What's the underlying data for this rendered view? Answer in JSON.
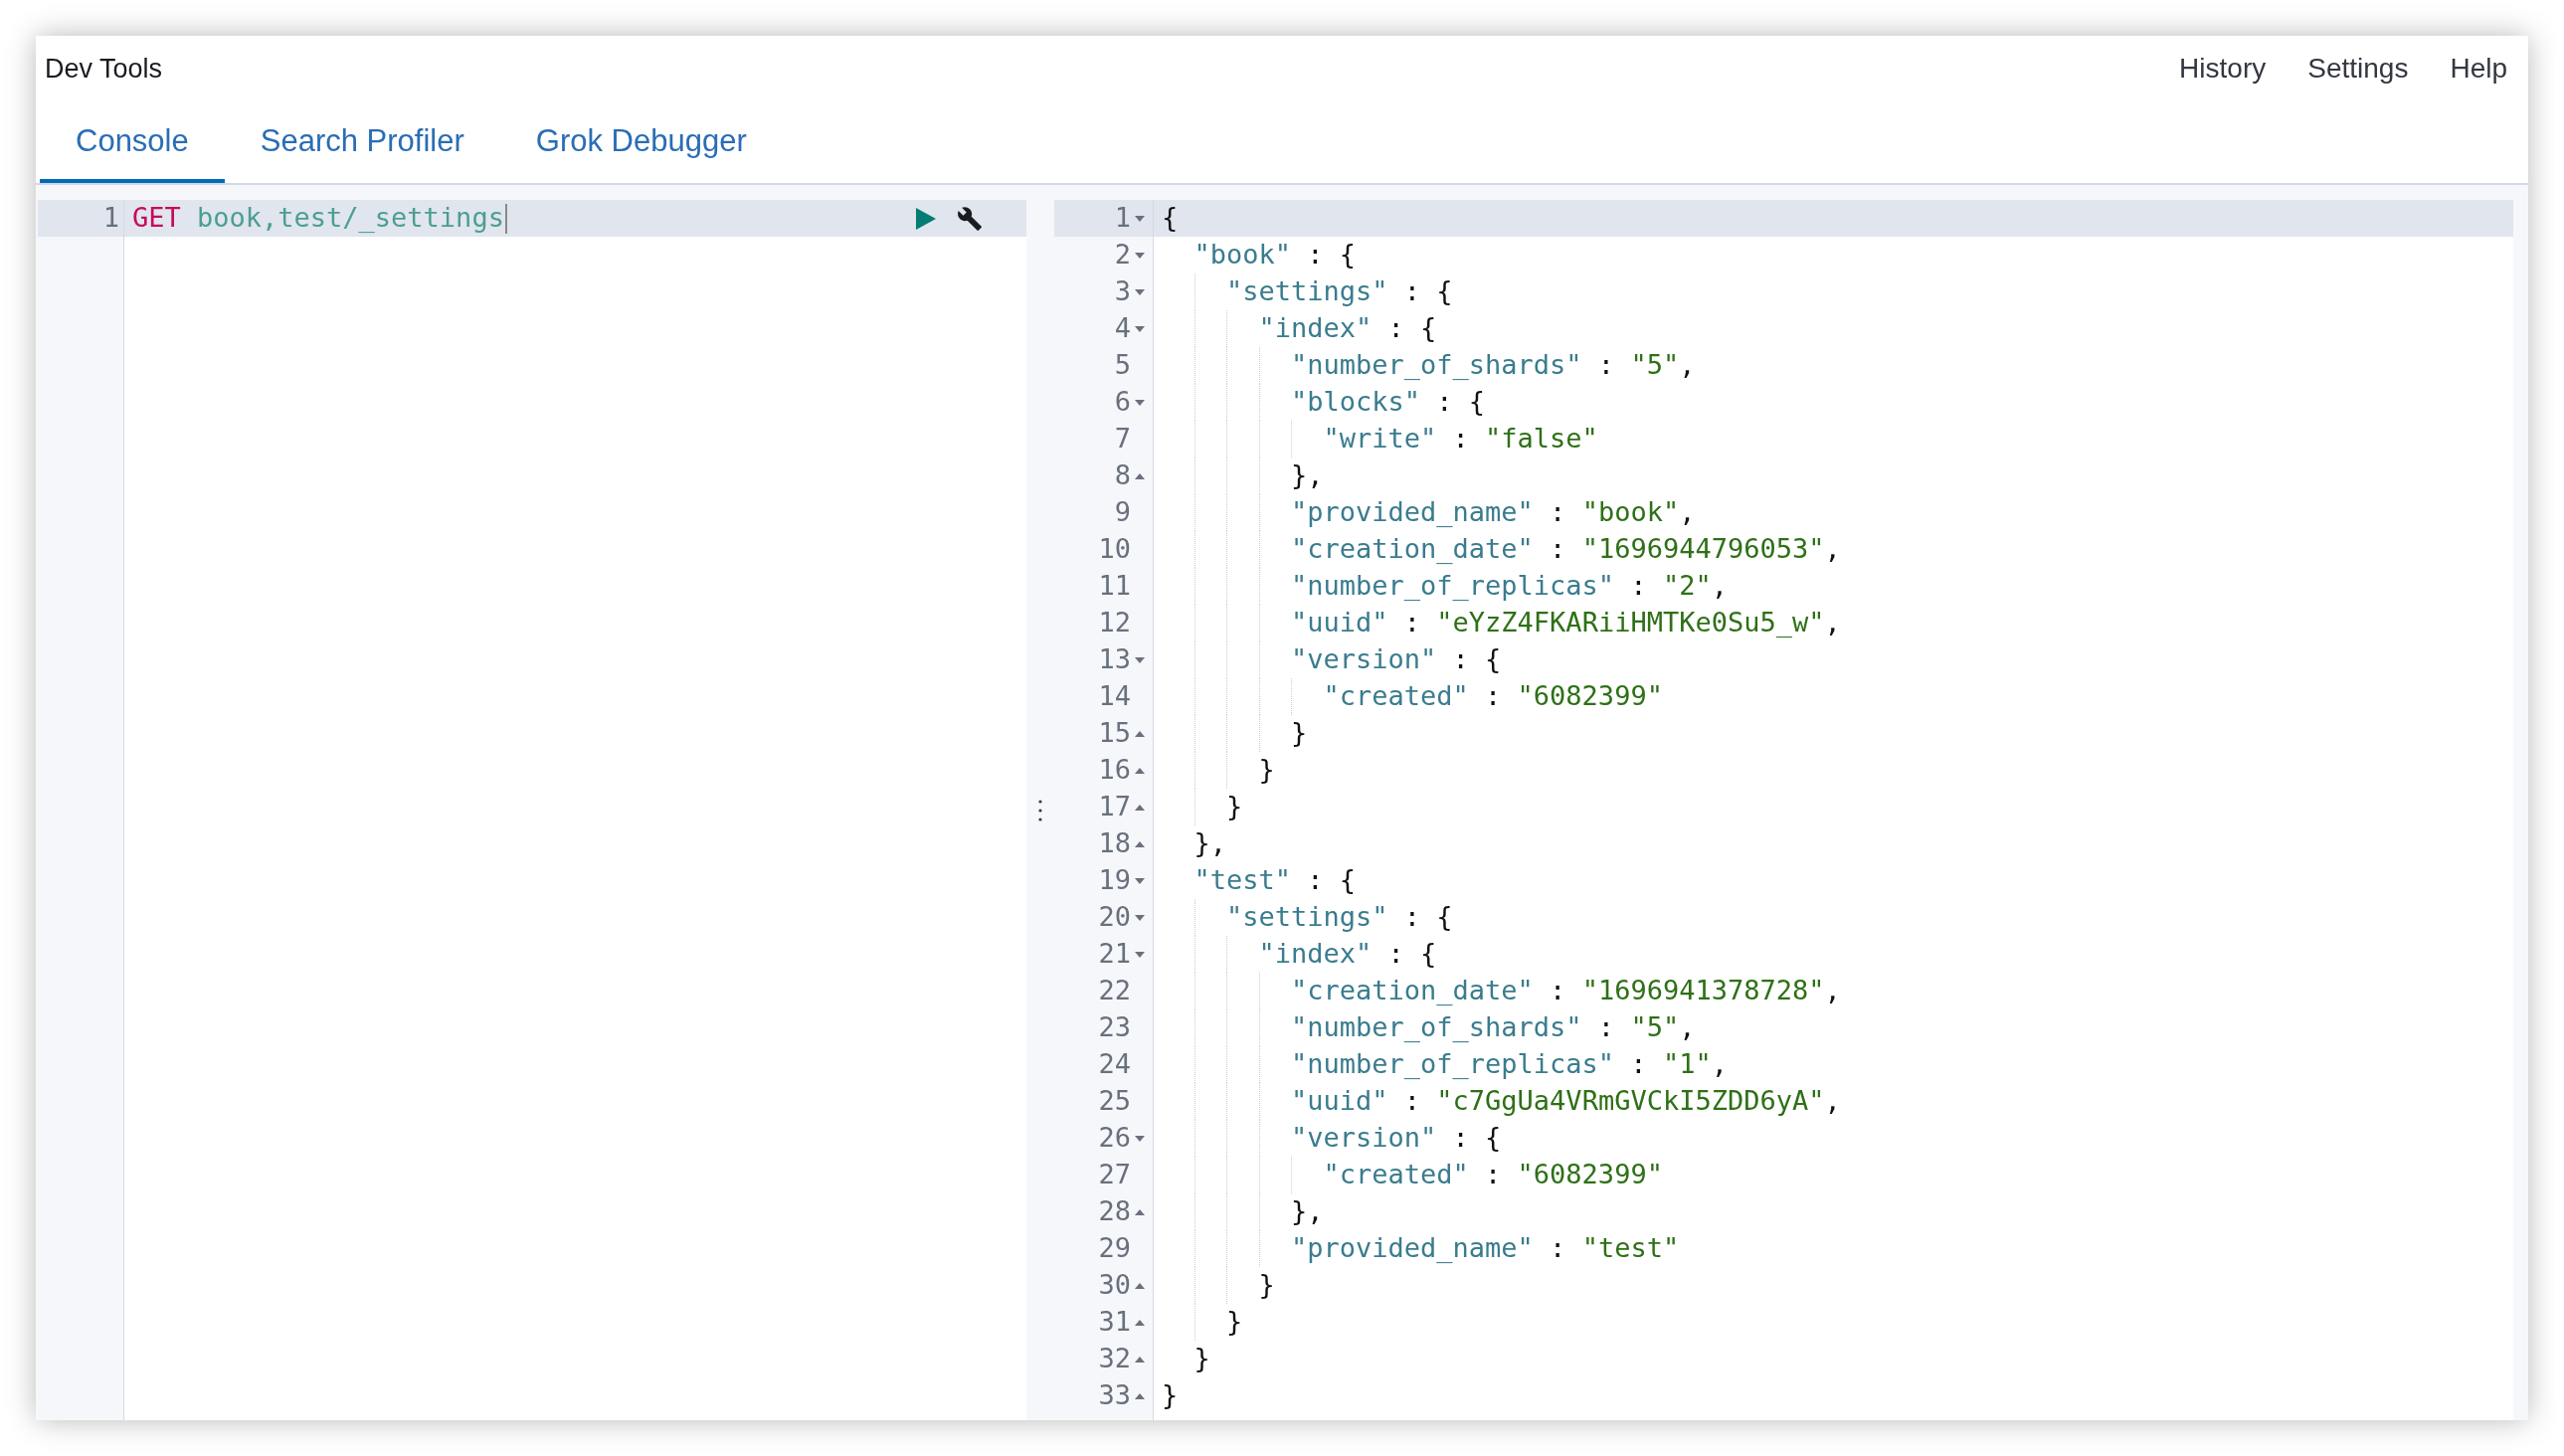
{
  "window": {
    "title": "Dev Tools"
  },
  "header_links": [
    "History",
    "Settings",
    "Help"
  ],
  "tabs": [
    {
      "label": "Console",
      "selected": true
    },
    {
      "label": "Search Profiler",
      "selected": false
    },
    {
      "label": "Grok Debugger",
      "selected": false
    }
  ],
  "request_editor": {
    "lines": [
      {
        "number": "1",
        "active": true,
        "cursor": true,
        "tokens": [
          {
            "kind": "method",
            "text": "GET"
          },
          {
            "kind": "url",
            "text": " book,test/_settings"
          }
        ]
      }
    ]
  },
  "response": {
    "lines": [
      {
        "number": "1",
        "fold_start": true,
        "fold_end": false,
        "active": true,
        "tokens": [
          {
            "kind": "punct",
            "text": "{"
          }
        ],
        "children": [
          {
            "number": "2",
            "fold_start": true,
            "fold_end": false,
            "active": false,
            "tokens": [
              {
                "kind": "key",
                "text": "\"book\""
              },
              {
                "kind": "punct",
                "text": " : {"
              }
            ],
            "children": [
              {
                "number": "3",
                "fold_start": true,
                "fold_end": false,
                "active": false,
                "tokens": [
                  {
                    "kind": "key",
                    "text": "\"settings\""
                  },
                  {
                    "kind": "punct",
                    "text": " : {"
                  }
                ],
                "children": [
                  {
                    "number": "4",
                    "fold_start": true,
                    "fold_end": false,
                    "active": false,
                    "tokens": [
                      {
                        "kind": "key",
                        "text": "\"index\""
                      },
                      {
                        "kind": "punct",
                        "text": " : {"
                      }
                    ],
                    "children": [
                      {
                        "number": "5",
                        "fold_start": false,
                        "fold_end": false,
                        "active": false,
                        "tokens": [
                          {
                            "kind": "key",
                            "text": "\"number_of_shards\""
                          },
                          {
                            "kind": "punct",
                            "text": " : "
                          },
                          {
                            "kind": "string",
                            "text": "\"5\""
                          },
                          {
                            "kind": "punct",
                            "text": ","
                          }
                        ]
                      },
                      {
                        "number": "6",
                        "fold_start": true,
                        "fold_end": false,
                        "active": false,
                        "tokens": [
                          {
                            "kind": "key",
                            "text": "\"blocks\""
                          },
                          {
                            "kind": "punct",
                            "text": " : {"
                          }
                        ],
                        "children": [
                          {
                            "number": "7",
                            "fold_start": false,
                            "fold_end": false,
                            "active": false,
                            "tokens": [
                              {
                                "kind": "key",
                                "text": "\"write\""
                              },
                              {
                                "kind": "punct",
                                "text": " : "
                              },
                              {
                                "kind": "string",
                                "text": "\"false\""
                              }
                            ]
                          }
                        ]
                      },
                      {
                        "number": "8",
                        "fold_start": false,
                        "fold_end": true,
                        "active": false,
                        "tokens": [
                          {
                            "kind": "punct",
                            "text": "},"
                          }
                        ]
                      },
                      {
                        "number": "9",
                        "fold_start": false,
                        "fold_end": false,
                        "active": false,
                        "tokens": [
                          {
                            "kind": "key",
                            "text": "\"provided_name\""
                          },
                          {
                            "kind": "punct",
                            "text": " : "
                          },
                          {
                            "kind": "string",
                            "text": "\"book\""
                          },
                          {
                            "kind": "punct",
                            "text": ","
                          }
                        ]
                      },
                      {
                        "number": "10",
                        "fold_start": false,
                        "fold_end": false,
                        "active": false,
                        "tokens": [
                          {
                            "kind": "key",
                            "text": "\"creation_date\""
                          },
                          {
                            "kind": "punct",
                            "text": " : "
                          },
                          {
                            "kind": "string",
                            "text": "\"1696944796053\""
                          },
                          {
                            "kind": "punct",
                            "text": ","
                          }
                        ]
                      },
                      {
                        "number": "11",
                        "fold_start": false,
                        "fold_end": false,
                        "active": false,
                        "tokens": [
                          {
                            "kind": "key",
                            "text": "\"number_of_replicas\""
                          },
                          {
                            "kind": "punct",
                            "text": " : "
                          },
                          {
                            "kind": "string",
                            "text": "\"2\""
                          },
                          {
                            "kind": "punct",
                            "text": ","
                          }
                        ]
                      },
                      {
                        "number": "12",
                        "fold_start": false,
                        "fold_end": false,
                        "active": false,
                        "tokens": [
                          {
                            "kind": "key",
                            "text": "\"uuid\""
                          },
                          {
                            "kind": "punct",
                            "text": " : "
                          },
                          {
                            "kind": "string",
                            "text": "\"eYzZ4FKARiiHMTKe0Su5_w\""
                          },
                          {
                            "kind": "punct",
                            "text": ","
                          }
                        ]
                      },
                      {
                        "number": "13",
                        "fold_start": true,
                        "fold_end": false,
                        "active": false,
                        "tokens": [
                          {
                            "kind": "key",
                            "text": "\"version\""
                          },
                          {
                            "kind": "punct",
                            "text": " : {"
                          }
                        ],
                        "children": [
                          {
                            "number": "14",
                            "fold_start": false,
                            "fold_end": false,
                            "active": false,
                            "tokens": [
                              {
                                "kind": "key",
                                "text": "\"created\""
                              },
                              {
                                "kind": "punct",
                                "text": " : "
                              },
                              {
                                "kind": "string",
                                "text": "\"6082399\""
                              }
                            ]
                          }
                        ]
                      },
                      {
                        "number": "15",
                        "fold_start": false,
                        "fold_end": true,
                        "active": false,
                        "tokens": [
                          {
                            "kind": "punct",
                            "text": "}"
                          }
                        ]
                      }
                    ]
                  },
                  {
                    "number": "16",
                    "fold_start": false,
                    "fold_end": true,
                    "active": false,
                    "tokens": [
                      {
                        "kind": "punct",
                        "text": "}"
                      }
                    ]
                  }
                ]
              },
              {
                "number": "17",
                "fold_start": false,
                "fold_end": true,
                "active": false,
                "tokens": [
                  {
                    "kind": "punct",
                    "text": "}"
                  }
                ]
              }
            ]
          },
          {
            "number": "18",
            "fold_start": false,
            "fold_end": true,
            "active": false,
            "tokens": [
              {
                "kind": "punct",
                "text": "},"
              }
            ]
          },
          {
            "number": "19",
            "fold_start": true,
            "fold_end": false,
            "active": false,
            "tokens": [
              {
                "kind": "key",
                "text": "\"test\""
              },
              {
                "kind": "punct",
                "text": " : {"
              }
            ],
            "children": [
              {
                "number": "20",
                "fold_start": true,
                "fold_end": false,
                "active": false,
                "tokens": [
                  {
                    "kind": "key",
                    "text": "\"settings\""
                  },
                  {
                    "kind": "punct",
                    "text": " : {"
                  }
                ],
                "children": [
                  {
                    "number": "21",
                    "fold_start": true,
                    "fold_end": false,
                    "active": false,
                    "tokens": [
                      {
                        "kind": "key",
                        "text": "\"index\""
                      },
                      {
                        "kind": "punct",
                        "text": " : {"
                      }
                    ],
                    "children": [
                      {
                        "number": "22",
                        "fold_start": false,
                        "fold_end": false,
                        "active": false,
                        "tokens": [
                          {
                            "kind": "key",
                            "text": "\"creation_date\""
                          },
                          {
                            "kind": "punct",
                            "text": " : "
                          },
                          {
                            "kind": "string",
                            "text": "\"1696941378728\""
                          },
                          {
                            "kind": "punct",
                            "text": ","
                          }
                        ]
                      },
                      {
                        "number": "23",
                        "fold_start": false,
                        "fold_end": false,
                        "active": false,
                        "tokens": [
                          {
                            "kind": "key",
                            "text": "\"number_of_shards\""
                          },
                          {
                            "kind": "punct",
                            "text": " : "
                          },
                          {
                            "kind": "string",
                            "text": "\"5\""
                          },
                          {
                            "kind": "punct",
                            "text": ","
                          }
                        ]
                      },
                      {
                        "number": "24",
                        "fold_start": false,
                        "fold_end": false,
                        "active": false,
                        "tokens": [
                          {
                            "kind": "key",
                            "text": "\"number_of_replicas\""
                          },
                          {
                            "kind": "punct",
                            "text": " : "
                          },
                          {
                            "kind": "string",
                            "text": "\"1\""
                          },
                          {
                            "kind": "punct",
                            "text": ","
                          }
                        ]
                      },
                      {
                        "number": "25",
                        "fold_start": false,
                        "fold_end": false,
                        "active": false,
                        "tokens": [
                          {
                            "kind": "key",
                            "text": "\"uuid\""
                          },
                          {
                            "kind": "punct",
                            "text": " : "
                          },
                          {
                            "kind": "string",
                            "text": "\"c7GgUa4VRmGVCkI5ZDD6yA\""
                          },
                          {
                            "kind": "punct",
                            "text": ","
                          }
                        ]
                      },
                      {
                        "number": "26",
                        "fold_start": true,
                        "fold_end": false,
                        "active": false,
                        "tokens": [
                          {
                            "kind": "key",
                            "text": "\"version\""
                          },
                          {
                            "kind": "punct",
                            "text": " : {"
                          }
                        ],
                        "children": [
                          {
                            "number": "27",
                            "fold_start": false,
                            "fold_end": false,
                            "active": false,
                            "tokens": [
                              {
                                "kind": "key",
                                "text": "\"created\""
                              },
                              {
                                "kind": "punct",
                                "text": " : "
                              },
                              {
                                "kind": "string",
                                "text": "\"6082399\""
                              }
                            ]
                          }
                        ]
                      },
                      {
                        "number": "28",
                        "fold_start": false,
                        "fold_end": true,
                        "active": false,
                        "tokens": [
                          {
                            "kind": "punct",
                            "text": "},"
                          }
                        ]
                      },
                      {
                        "number": "29",
                        "fold_start": false,
                        "fold_end": false,
                        "active": false,
                        "tokens": [
                          {
                            "kind": "key",
                            "text": "\"provided_name\""
                          },
                          {
                            "kind": "punct",
                            "text": " : "
                          },
                          {
                            "kind": "string",
                            "text": "\"test\""
                          }
                        ]
                      }
                    ]
                  },
                  {
                    "number": "30",
                    "fold_start": false,
                    "fold_end": true,
                    "active": false,
                    "tokens": [
                      {
                        "kind": "punct",
                        "text": "}"
                      }
                    ]
                  }
                ]
              },
              {
                "number": "31",
                "fold_start": false,
                "fold_end": true,
                "active": false,
                "tokens": [
                  {
                    "kind": "punct",
                    "text": "}"
                  }
                ]
              }
            ]
          },
          {
            "number": "32",
            "fold_start": false,
            "fold_end": true,
            "active": false,
            "tokens": [
              {
                "kind": "punct",
                "text": "}"
              }
            ]
          }
        ]
      },
      {
        "number": "33",
        "fold_start": false,
        "fold_end": true,
        "active": false,
        "tokens": [
          {
            "kind": "punct",
            "text": "}"
          }
        ]
      }
    ]
  }
}
